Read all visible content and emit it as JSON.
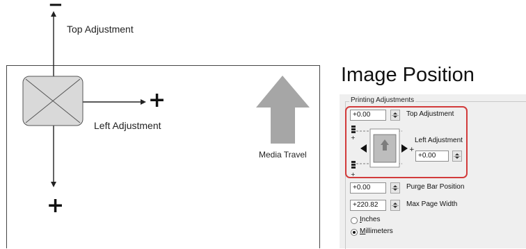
{
  "diagram": {
    "minus_sign": "−",
    "plus_sign_right": "+",
    "plus_sign_bottom": "+",
    "top_adjustment_label": "Top Adjustment",
    "left_adjustment_label": "Left Adjustment",
    "media_travel_label": "Media Travel"
  },
  "panel": {
    "title": "Image Position",
    "group_label": "Printing Adjustments",
    "top_adjustment": {
      "value": "+0.00",
      "label": "Top Adjustment"
    },
    "left_adjustment": {
      "value": "+0.00",
      "label": "Left Adjustment"
    },
    "purge_bar_position": {
      "value": "+0.00",
      "label": "Purge Bar Position"
    },
    "max_page_width": {
      "value": "+220.82",
      "label": "Max Page Width"
    },
    "units": {
      "options": [
        {
          "label": "Inches",
          "underline": "I",
          "rest": "nches",
          "selected": false
        },
        {
          "label": "Millimeters",
          "underline": "M",
          "rest": "illimeters",
          "selected": true
        }
      ]
    },
    "colors": {
      "highlight": "#d23a3a",
      "panel_bg": "#efefef",
      "arrow_gray": "#a6a6a6"
    }
  }
}
